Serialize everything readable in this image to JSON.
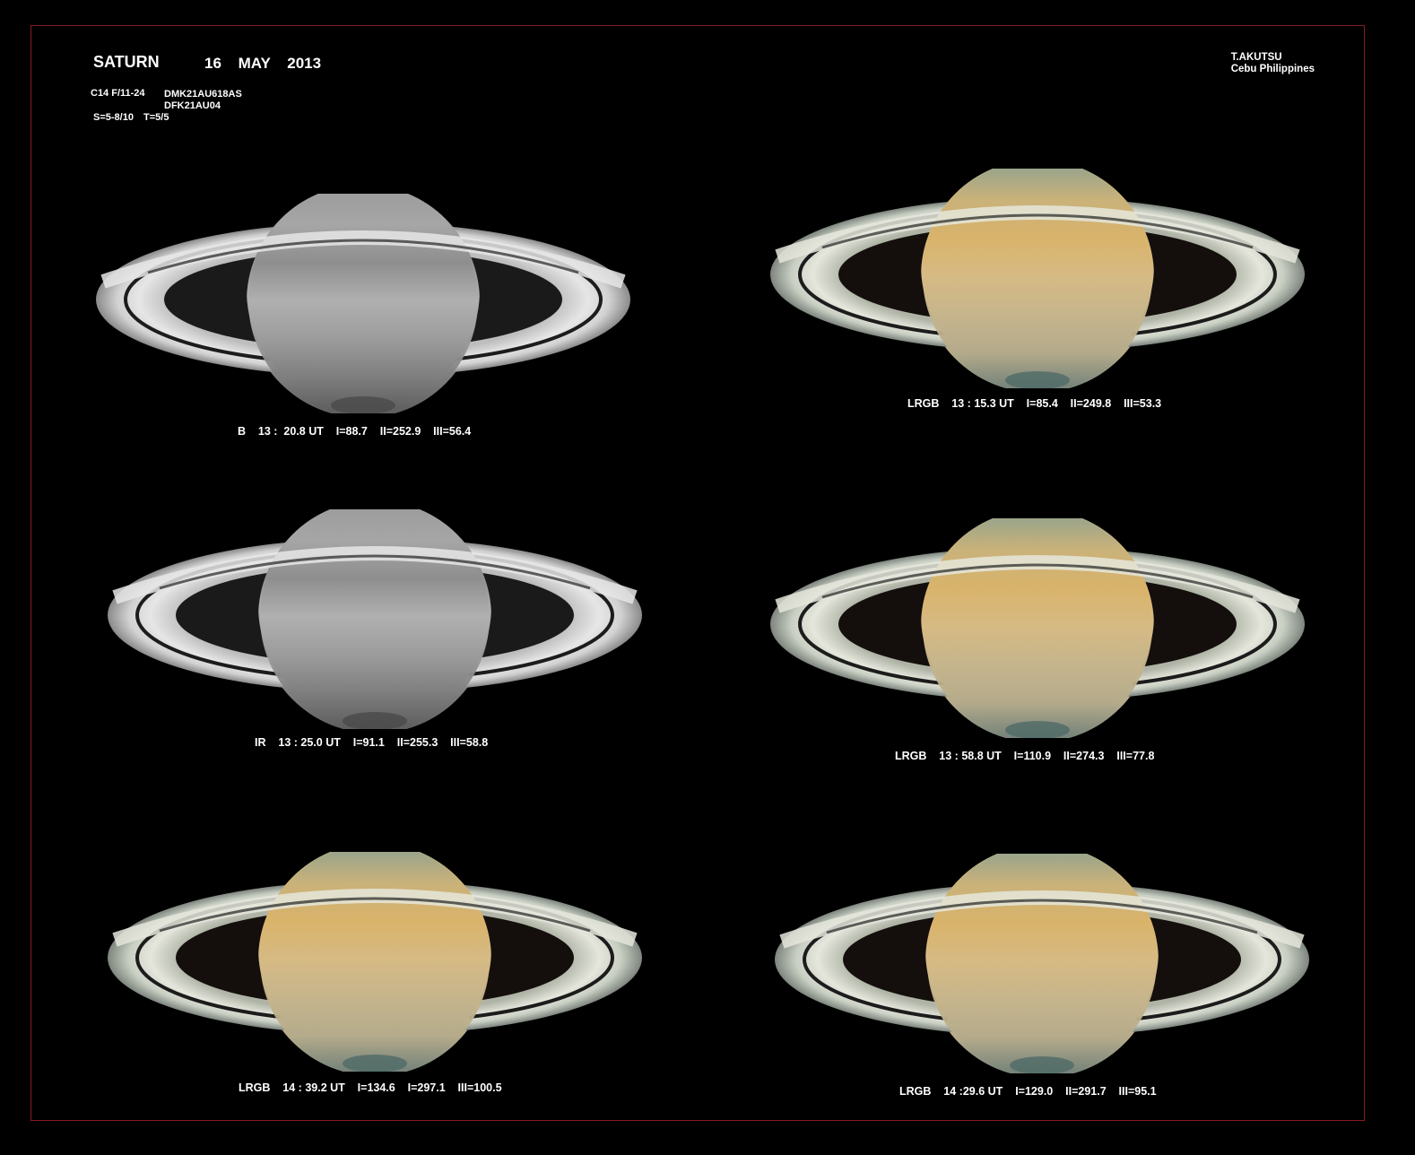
{
  "header": {
    "title": "SATURN",
    "date": "16  MAY   2013",
    "observer": "T.AKUTSU",
    "location": "Cebu  Philippines",
    "telescope": "C14  F/11-24",
    "camera_1": "DMK21AU618AS",
    "camera_2": "DFK21AU04",
    "conditions": "S=5-8/10    T=5/5"
  },
  "colors": {
    "frame": "#8a1a22",
    "background": "#000000"
  },
  "images": [
    {
      "filter": "B",
      "caption": "B    13 :  20.8 UT    I=88.7    II=252.9    III=56.4",
      "style": "mono"
    },
    {
      "filter": "LRGB",
      "caption": "LRGB    13 : 15.3 UT    I=85.4    II=249.8    III=53.3",
      "style": "color"
    },
    {
      "filter": "IR",
      "caption": "IR    13 : 25.0 UT    I=91.1    II=255.3    III=58.8",
      "style": "mono"
    },
    {
      "filter": "LRGB",
      "caption": "LRGB    13 : 58.8 UT    I=110.9    II=274.3    III=77.8",
      "style": "color"
    },
    {
      "filter": "LRGB",
      "caption": "LRGB    14 : 39.2 UT    I=134.6    I=297.1    III=100.5",
      "style": "color"
    },
    {
      "filter": "LRGB",
      "caption": "LRGB    14 :29.6 UT    I=129.0    II=291.7    III=95.1",
      "style": "color"
    }
  ]
}
